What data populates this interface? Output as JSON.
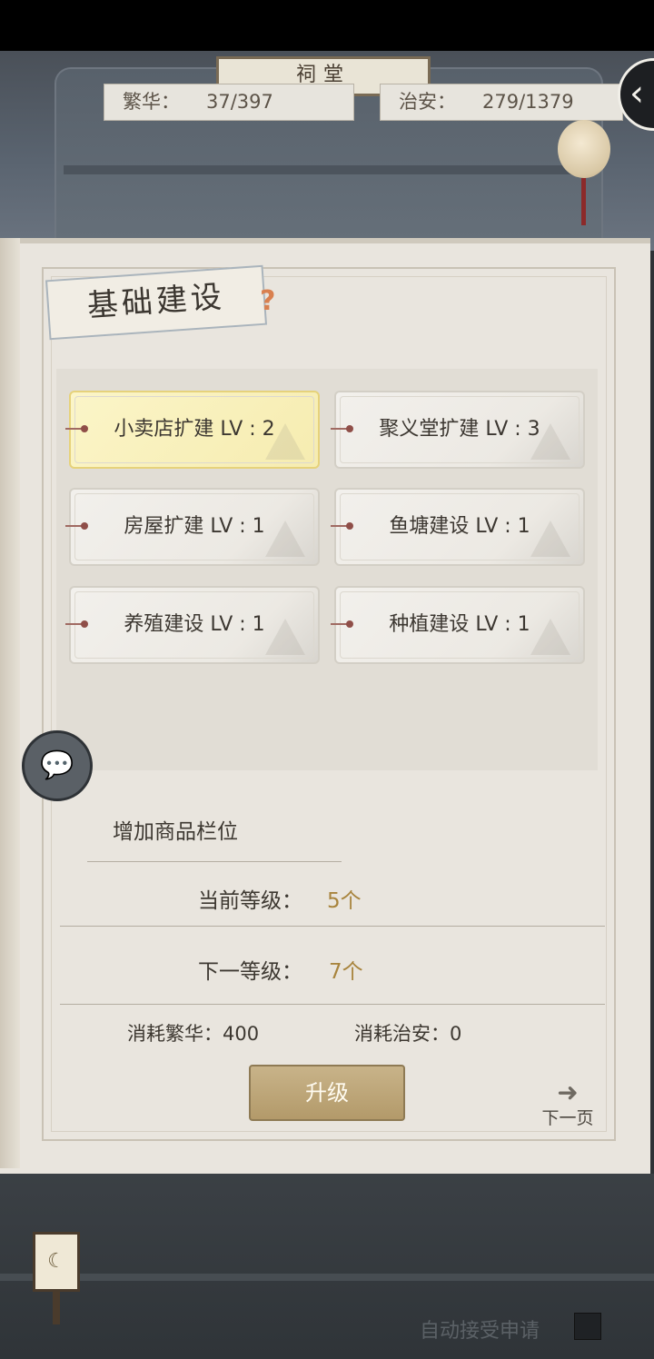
{
  "header": {
    "plaque_text": "祠堂",
    "prosperity": {
      "label": "繁华：",
      "value": "37/397"
    },
    "security": {
      "label": "治安：",
      "value": "279/1379"
    },
    "back_icon": "‹"
  },
  "panel": {
    "title": "基础建设",
    "help_icon": "?",
    "buildings": [
      {
        "label": "小卖店扩建 LV : 2",
        "active": true
      },
      {
        "label": "聚义堂扩建 LV : 3",
        "active": false
      },
      {
        "label": "房屋扩建 LV : 1",
        "active": false
      },
      {
        "label": "鱼塘建设 LV : 1",
        "active": false
      },
      {
        "label": "养殖建设 LV : 1",
        "active": false
      },
      {
        "label": "种植建设 LV : 1",
        "active": false
      }
    ],
    "detail": {
      "title": "增加商品栏位",
      "current_label": "当前等级：",
      "current_value": "5个",
      "next_label": "下一等级：",
      "next_value": "7个",
      "cost_prosperity": "消耗繁华：400",
      "cost_security": "消耗治安：0"
    },
    "upgrade_label": "升级",
    "next_page_label": "下一页",
    "next_page_icon": "➜"
  },
  "chat_icon": "💬",
  "footer": {
    "auto_accept_label": "自动接受申请",
    "lamp_icon": "☾"
  },
  "colors": {
    "accent_gold": "#a8843d",
    "active_card": "#f6ecb0",
    "button": "#b39a6a"
  }
}
